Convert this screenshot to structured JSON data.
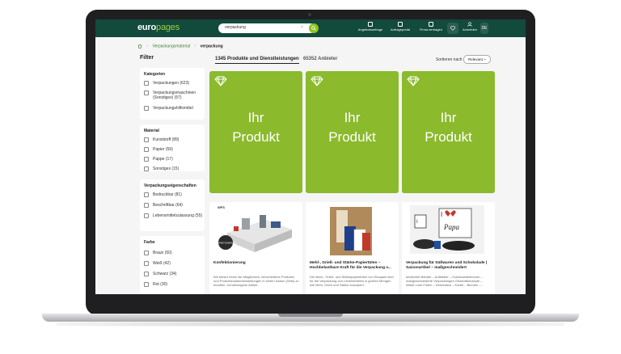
{
  "header": {
    "logo_euro": "euro",
    "logo_pages": "pages",
    "search_value": "verpackung",
    "search_clear": "×",
    "nav": [
      {
        "label": "Angebotsanfrage",
        "icon": "quote-request-icon"
      },
      {
        "label": "Anfrageportal",
        "icon": "inquiry-portal-icon"
      },
      {
        "label": "Firma eintragen",
        "icon": "register-company-icon"
      },
      {
        "label": "Anmelden",
        "icon": "user-icon"
      }
    ],
    "language": "DE"
  },
  "breadcrumb": {
    "parent": "Verpackungsmaterial",
    "current": "verpackung"
  },
  "sidebar": {
    "title": "Filter",
    "groups": [
      {
        "title": "Kategorien",
        "items": [
          "Verpackungen (623)",
          "Verpackungsmaschinen (Sonstiges) (57)",
          "Verpackungshilfsmittel"
        ]
      },
      {
        "title": "Material",
        "items": [
          "Kunststoff (89)",
          "Papier (59)",
          "Pappe (17)",
          "Sonstiges (15)"
        ]
      },
      {
        "title": "Verpackungseigenschaften",
        "items": [
          "Bedruckbar (81)",
          "Beschriftbar (64)",
          "Lebensmittelzulassung (55)"
        ]
      },
      {
        "title": "Farbe",
        "items": [
          "Braun (50)",
          "Weiß (42)",
          "Schwarz (34)",
          "Rot (30)"
        ]
      }
    ]
  },
  "results": {
    "products_tab": "1345 Produkte und Dienstleistungen",
    "suppliers_tab": "65352 Anbieter",
    "sort_label": "Sortieren nach",
    "sort_value": "Relevanz"
  },
  "promos": [
    {
      "line1": "Ihr",
      "line2": "Produkt"
    },
    {
      "line1": "Ihr",
      "line2": "Produkt"
    },
    {
      "line1": "Ihr",
      "line2": "Produkt"
    }
  ],
  "cards": [
    {
      "image_caption": "KONFEKTIONIERUNG",
      "image_brand": "WFS",
      "title": "Konfektionierung",
      "desc": "Wir bieten Ihnen die Möglichkeit, verschiedene Produkte und Produktzusammenstellungen in einem Karton (Sets) zu bündeln. Kundeneigene Artikel..."
    },
    {
      "title": "Mehl-, Grieß- und Stärke-Papiertüten – Hochbelastbare Kraft für die Verpackung v...",
      "desc": "Die Mehl-, Grieß- und Stärkepapiertüten von Ekopack sind für die Verpackung von Lebensmitteln in großen Mengen wie Mehl, Grieß und Stärke konzipiert."
    },
    {
      "image_word": "Papa",
      "image_heart_letter": "I",
      "title": "Verpackung für Süßwaren und Schokolade | Saisonartikel – maßgeschneidert",
      "desc": "bedruckte Bänder – Aufkleber – Schokoladenboxen – maßgeschneiderte Verpackungen Gesamtkonzepte – Waren zum Füllen – Dekoration – Körbe – Blumen –..."
    }
  ],
  "colors": {
    "header_bg": "#124a3b",
    "accent_green": "#8bba2d",
    "logo_green": "#9ad040"
  }
}
